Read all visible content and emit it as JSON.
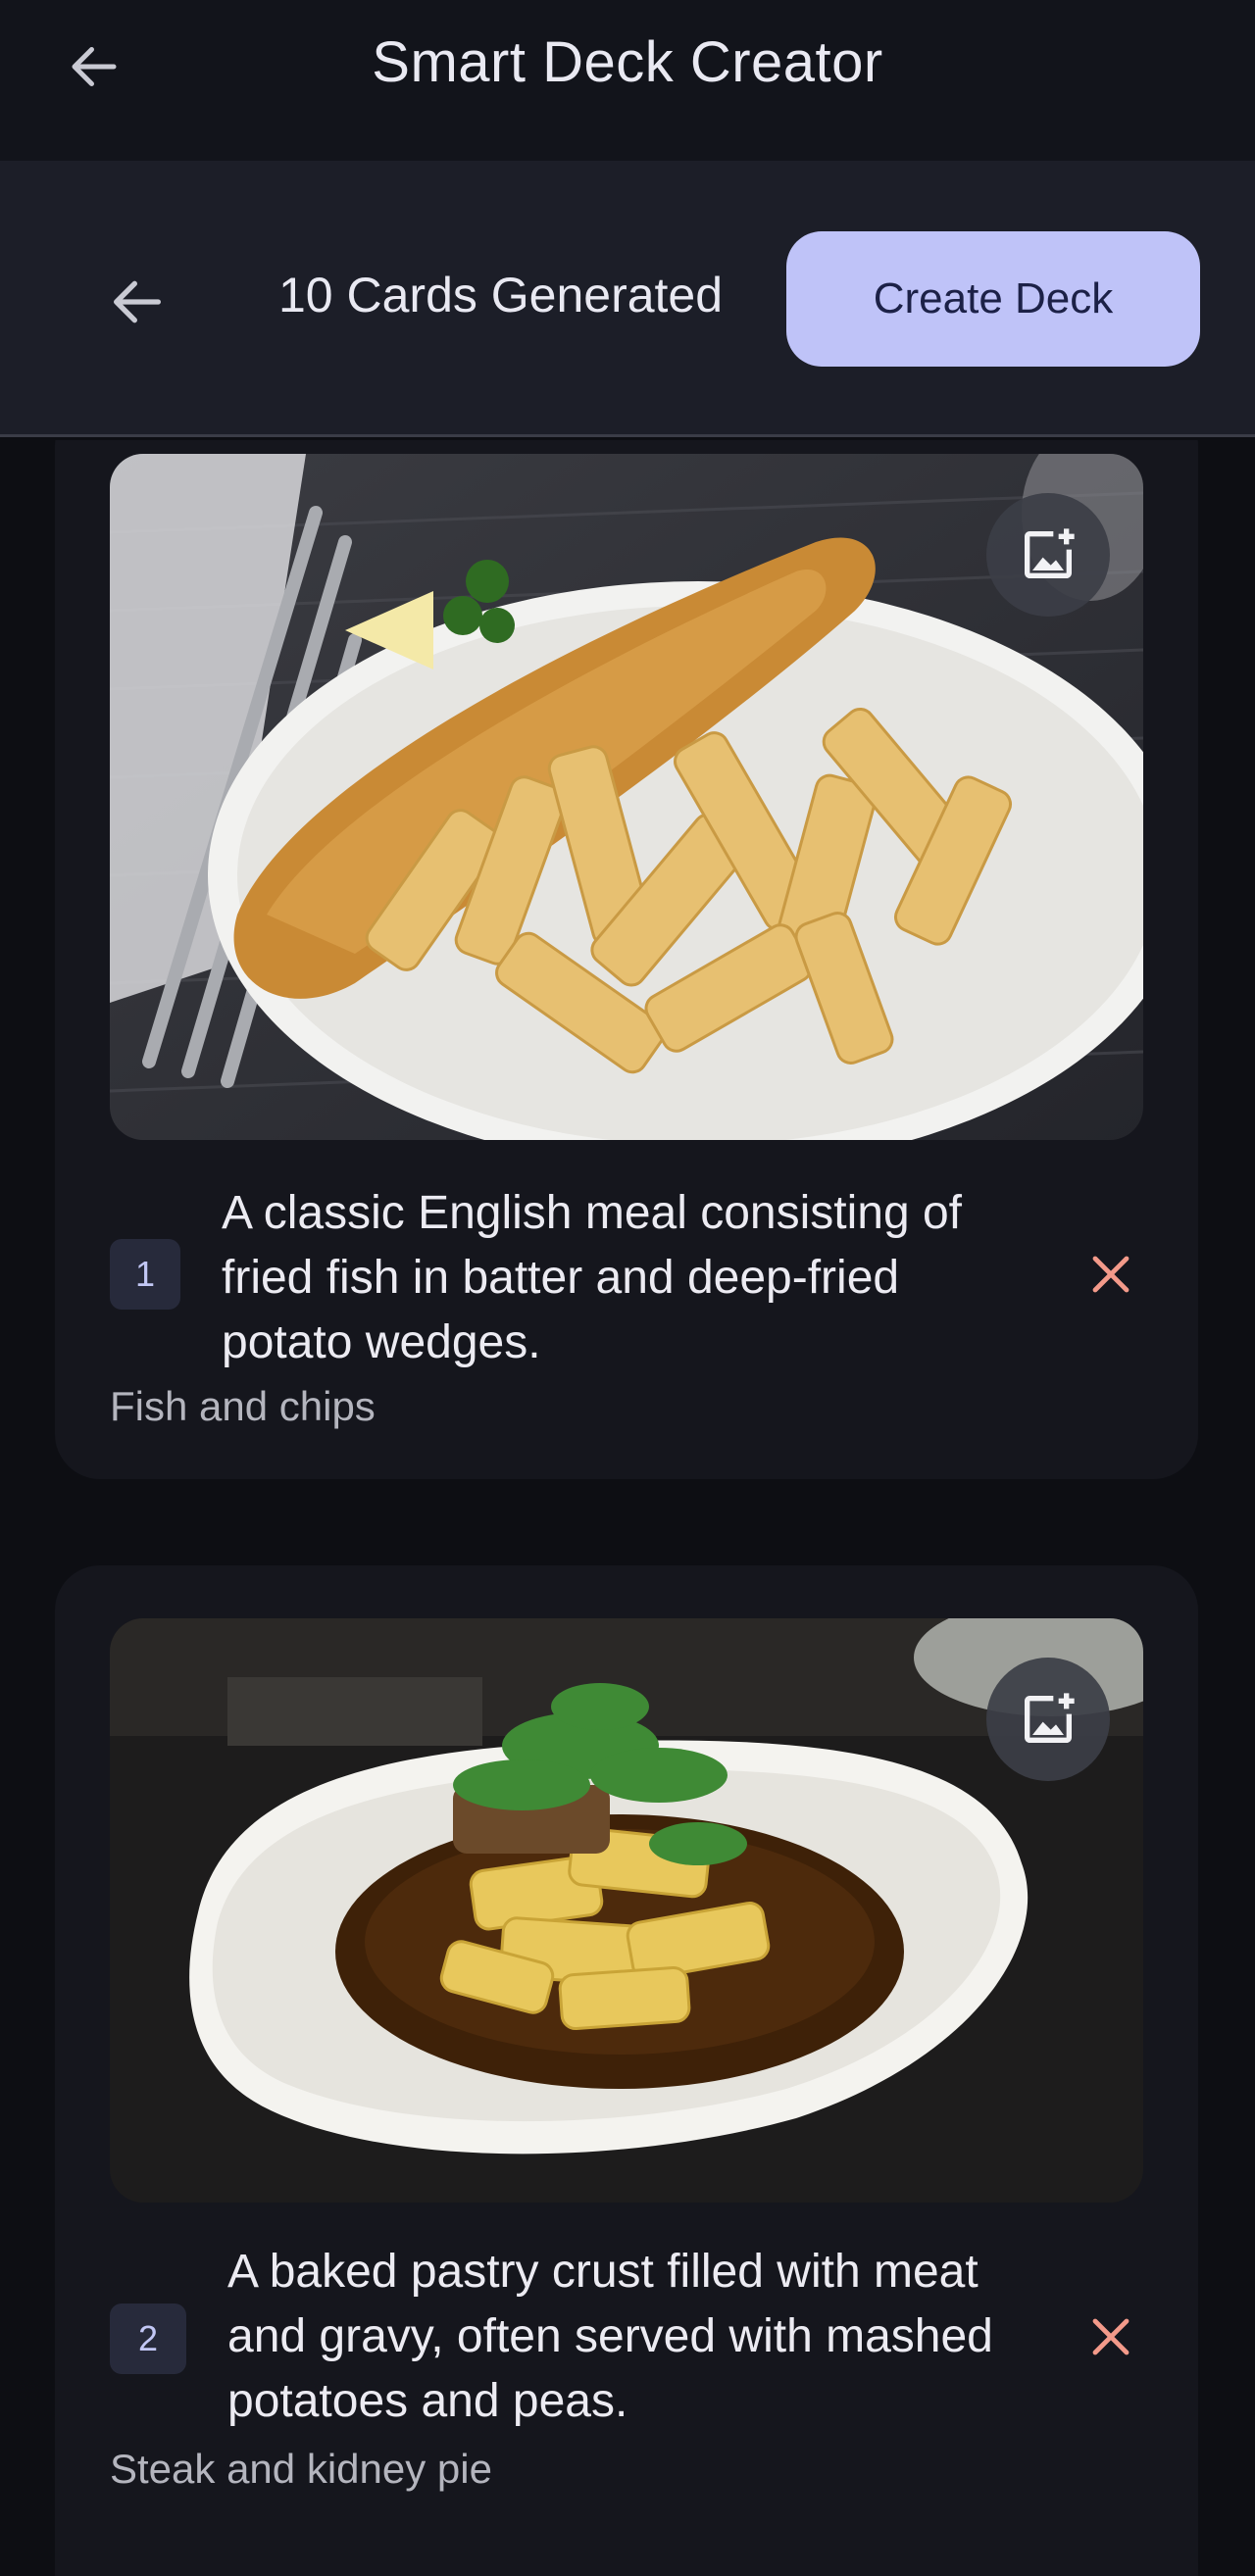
{
  "app_bar": {
    "title": "Smart Deck Creator",
    "back_icon": "arrow-left-icon"
  },
  "sub_bar": {
    "count_text": "10 Cards Generated",
    "create_label": "Create Deck",
    "back_icon": "arrow-left-icon"
  },
  "colors": {
    "accent": "#bfc3f8",
    "delete": "#f39a8a",
    "background": "#0d0e13",
    "card": "#15161d"
  },
  "cards": [
    {
      "number": "1",
      "description": "A classic English meal consisting of fried fish in batter and deep-fried potato wedges.",
      "label": "Fish and chips",
      "image_icon": "add-image-icon",
      "delete_icon": "close-icon"
    },
    {
      "number": "2",
      "description": "A baked pastry crust filled with meat and gravy, often served with mashed potatoes and peas.",
      "label": "Steak and kidney pie",
      "image_icon": "add-image-icon",
      "delete_icon": "close-icon"
    }
  ]
}
